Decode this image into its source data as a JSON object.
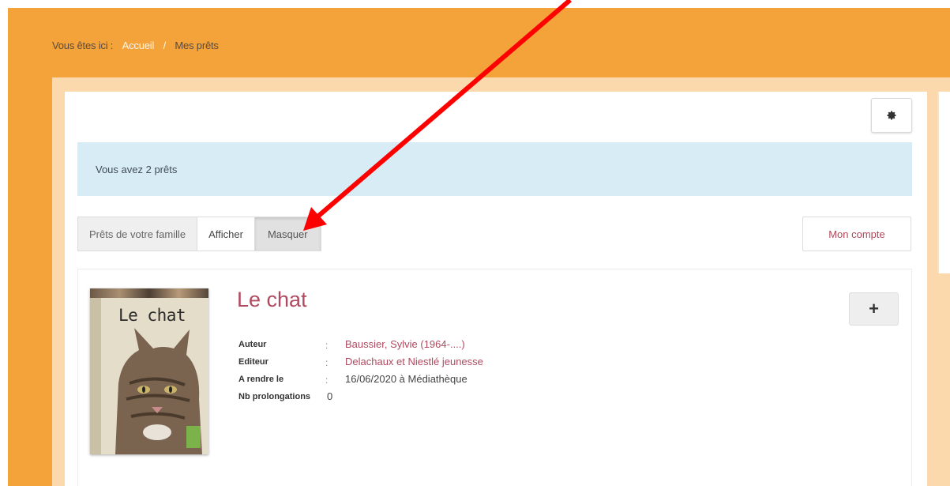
{
  "breadcrumb": {
    "prefix": "Vous êtes ici :",
    "home": "Accueil",
    "separator": "/",
    "current": "Mes prêts"
  },
  "toolbar": {
    "settings_icon": "gear-icon"
  },
  "banner": {
    "message": "Vous avez 2 prêts"
  },
  "family": {
    "label": "Prêts de votre famille",
    "show_label": "Afficher",
    "hide_label": "Masquer",
    "selected": "Masquer"
  },
  "account_button": "Mon compte",
  "loan": {
    "title": "Le chat",
    "cover_text": "Le chat",
    "fields": {
      "author_label": "Auteur",
      "author_value": "Baussier, Sylvie (1964-....)",
      "publisher_label": "Editeur",
      "publisher_value": "Delachaux et Niestlé jeunesse",
      "due_label": "A rendre le",
      "due_value": "16/06/2020 à Médiathèque",
      "renewals_label": "Nb prolongations",
      "renewals_value": "0"
    },
    "separator": ":",
    "expand_icon": "plus-icon"
  },
  "colors": {
    "page_orange": "#f4a23a",
    "panel_peach": "#fbd9ad",
    "info_blue": "#d8ecf6",
    "link_red": "#b04a60",
    "annotation_red": "#ff0000"
  }
}
